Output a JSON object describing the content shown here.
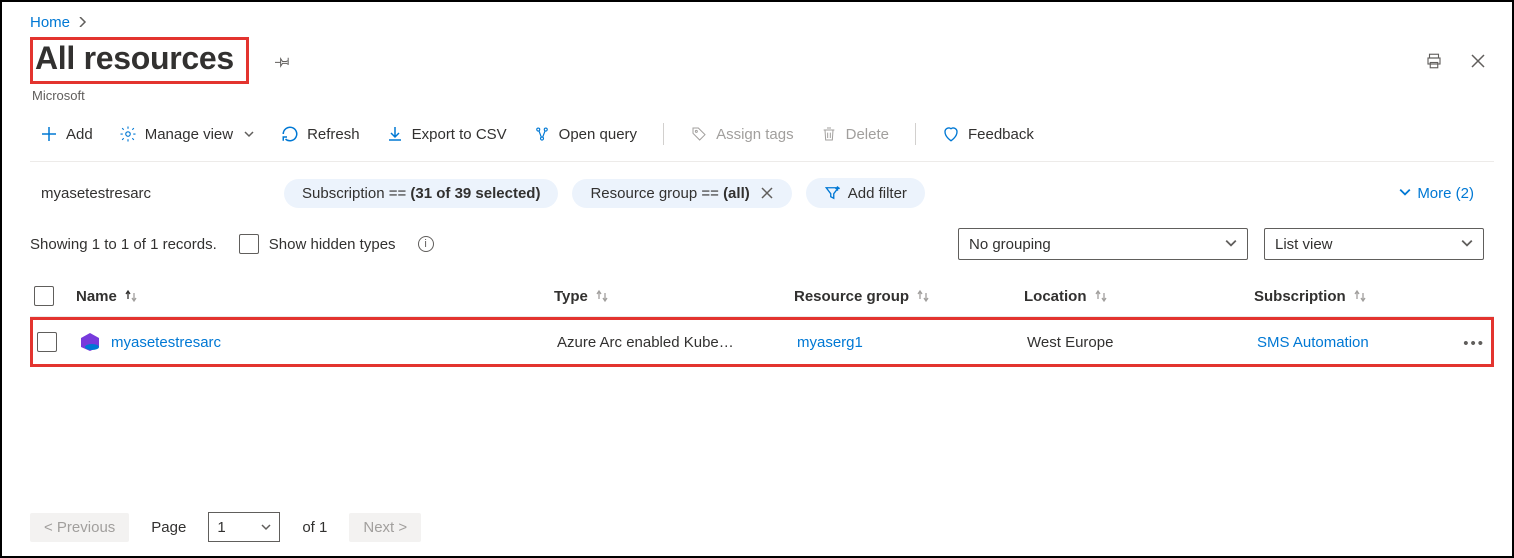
{
  "breadcrumb": {
    "home": "Home"
  },
  "title": "All resources",
  "subtitle": "Microsoft",
  "toolbar": {
    "add": "Add",
    "manage_view": "Manage view",
    "refresh": "Refresh",
    "export_csv": "Export to CSV",
    "open_query": "Open query",
    "assign_tags": "Assign tags",
    "delete": "Delete",
    "feedback": "Feedback"
  },
  "filters": {
    "search_value": "myasetestresarc",
    "subscription_label": "Subscription == ",
    "subscription_value": "(31 of 39 selected)",
    "rg_label": "Resource group == ",
    "rg_value": "(all)",
    "add_filter": "Add filter",
    "more": "More (2)"
  },
  "status": {
    "showing": "Showing 1 to 1 of 1 records.",
    "show_hidden": "Show hidden types",
    "grouping": "No grouping",
    "view": "List view"
  },
  "columns": {
    "name": "Name",
    "type": "Type",
    "rg": "Resource group",
    "loc": "Location",
    "sub": "Subscription"
  },
  "rows": [
    {
      "name": "myasetestresarc",
      "type": "Azure Arc enabled Kube…",
      "rg": "myaserg1",
      "loc": "West Europe",
      "sub": "SMS Automation"
    }
  ],
  "pager": {
    "prev": "< Previous",
    "page_label": "Page",
    "page": "1",
    "of": "of 1",
    "next": "Next >"
  }
}
